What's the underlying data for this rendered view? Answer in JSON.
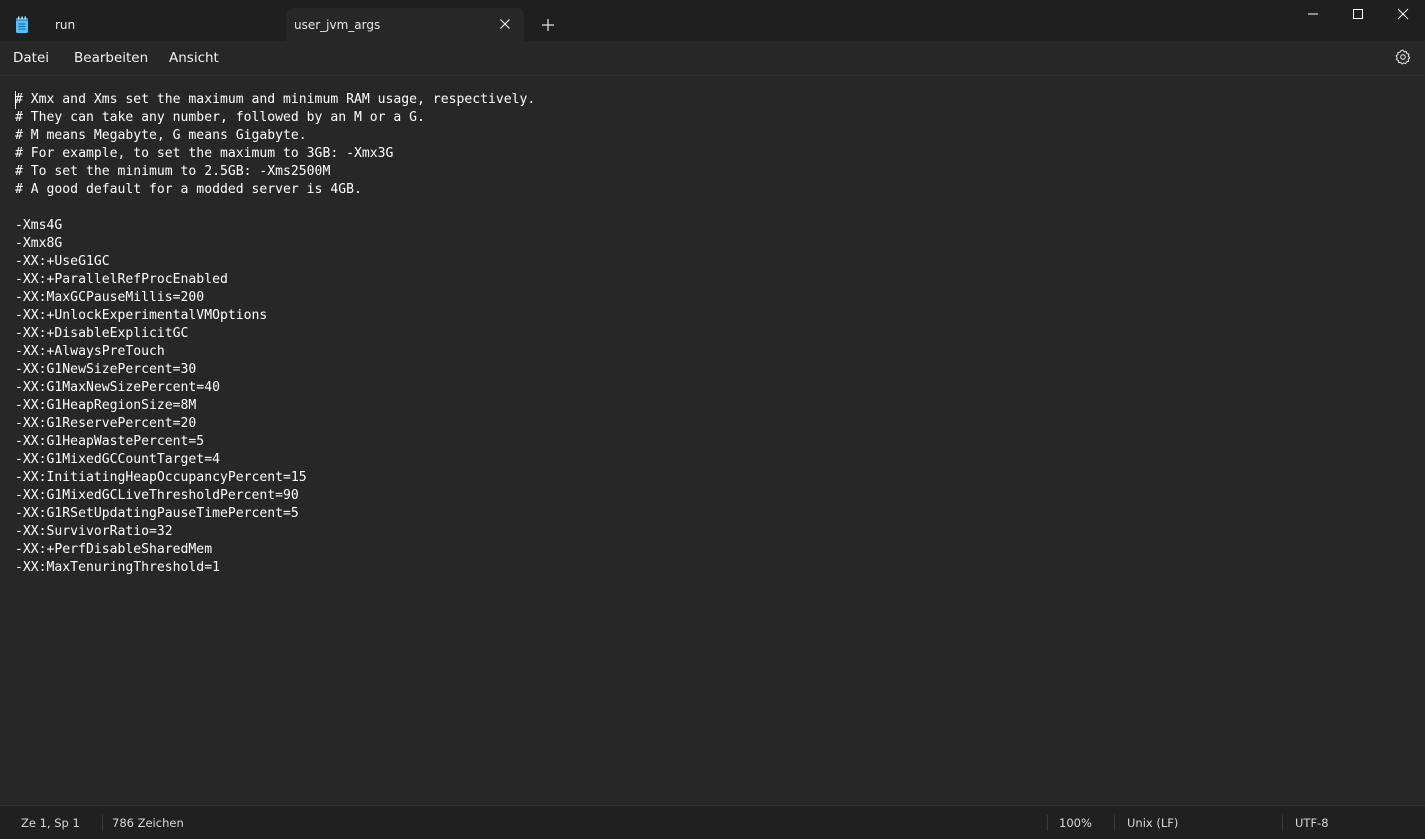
{
  "tabs": [
    {
      "label": "run",
      "active": false
    },
    {
      "label": "user_jvm_args",
      "active": true
    }
  ],
  "menu": {
    "datei": "Datei",
    "bearbeiten": "Bearbeiten",
    "ansicht": "Ansicht"
  },
  "editor": {
    "lines": [
      "# Xmx and Xms set the maximum and minimum RAM usage, respectively.",
      "# They can take any number, followed by an M or a G.",
      "# M means Megabyte, G means Gigabyte.",
      "# For example, to set the maximum to 3GB: -Xmx3G",
      "# To set the minimum to 2.5GB: -Xms2500M",
      "# A good default for a modded server is 4GB.",
      "",
      "-Xms4G",
      "-Xmx8G",
      "-XX:+UseG1GC",
      "-XX:+ParallelRefProcEnabled",
      "-XX:MaxGCPauseMillis=200",
      "-XX:+UnlockExperimentalVMOptions",
      "-XX:+DisableExplicitGC",
      "-XX:+AlwaysPreTouch",
      "-XX:G1NewSizePercent=30",
      "-XX:G1MaxNewSizePercent=40",
      "-XX:G1HeapRegionSize=8M",
      "-XX:G1ReservePercent=20",
      "-XX:G1HeapWastePercent=5",
      "-XX:G1MixedGCCountTarget=4",
      "-XX:InitiatingHeapOccupancyPercent=15",
      "-XX:G1MixedGCLiveThresholdPercent=90",
      "-XX:G1RSetUpdatingPauseTimePercent=5",
      "-XX:SurvivorRatio=32",
      "-XX:+PerfDisableSharedMem",
      "-XX:MaxTenuringThreshold=1"
    ]
  },
  "status": {
    "position": "Ze 1, Sp 1",
    "char_count": "786 Zeichen",
    "zoom": "100%",
    "line_ending": "Unix (LF)",
    "encoding": "UTF-8"
  },
  "colors": {
    "background": "#272727",
    "titlebar": "#1f1f1f",
    "statusbar": "#202020",
    "spellcheck_underline": "#e81123"
  }
}
